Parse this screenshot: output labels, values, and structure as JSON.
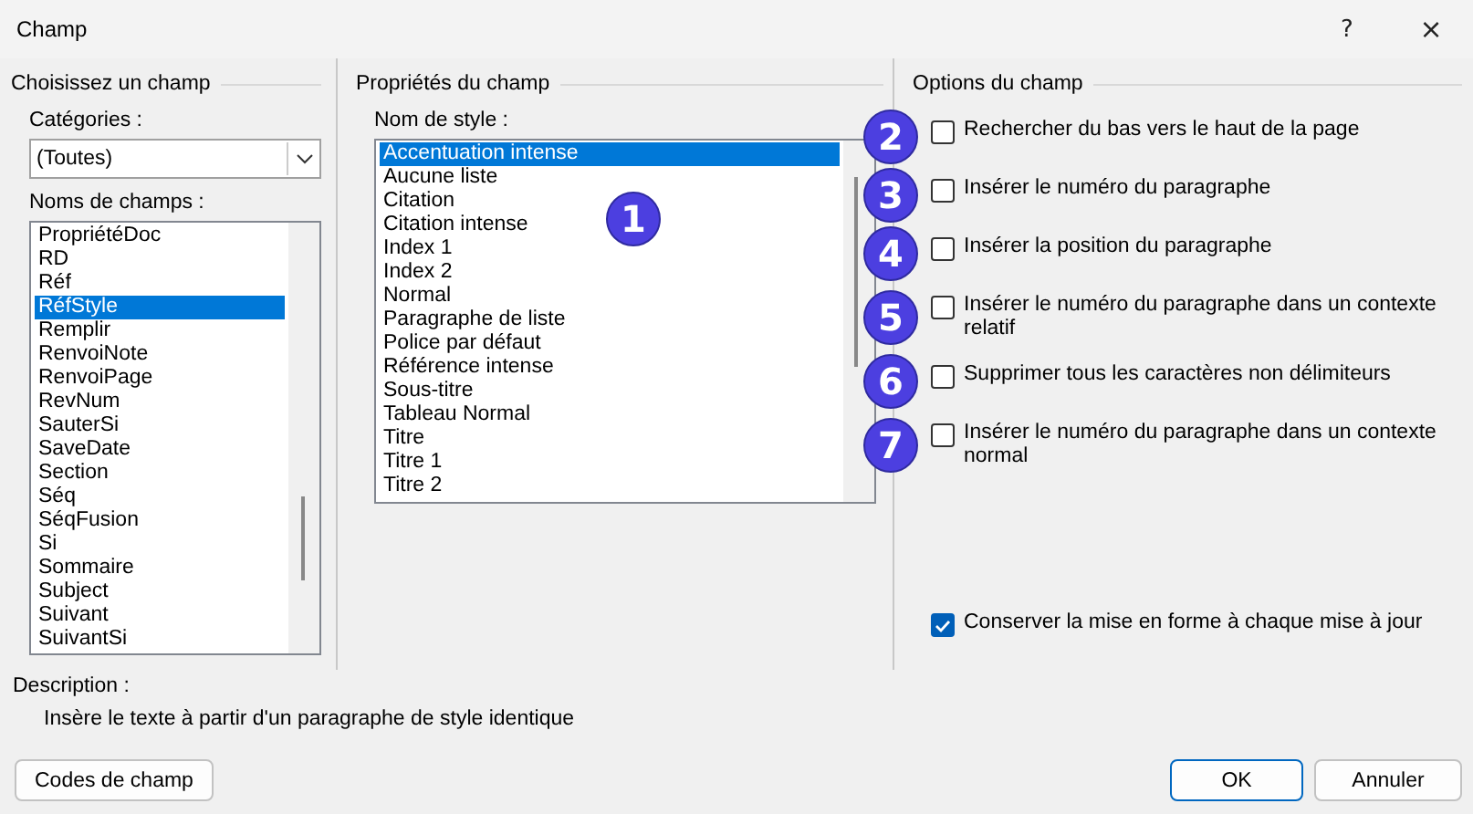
{
  "window": {
    "title": "Champ",
    "help": "?",
    "close": "×"
  },
  "field_chooser": {
    "heading": "Choisissez un champ",
    "categories_label": "Catégories :",
    "categories_value": "(Toutes)",
    "names_label": "Noms de champs :",
    "names": [
      {
        "label": "PropriétéDoc",
        "selected": false
      },
      {
        "label": "RD",
        "selected": false
      },
      {
        "label": "Réf",
        "selected": false
      },
      {
        "label": "RéfStyle",
        "selected": true
      },
      {
        "label": "Remplir",
        "selected": false
      },
      {
        "label": "RenvoiNote",
        "selected": false
      },
      {
        "label": "RenvoiPage",
        "selected": false
      },
      {
        "label": "RevNum",
        "selected": false
      },
      {
        "label": "SauterSi",
        "selected": false
      },
      {
        "label": "SaveDate",
        "selected": false
      },
      {
        "label": "Section",
        "selected": false
      },
      {
        "label": "Séq",
        "selected": false
      },
      {
        "label": "SéqFusion",
        "selected": false
      },
      {
        "label": "Si",
        "selected": false
      },
      {
        "label": "Sommaire",
        "selected": false
      },
      {
        "label": "Subject",
        "selected": false
      },
      {
        "label": "Suivant",
        "selected": false
      },
      {
        "label": "SuivantSi",
        "selected": false
      }
    ]
  },
  "field_properties": {
    "heading": "Propriétés du champ",
    "style_label": "Nom de style :",
    "callout": "1",
    "styles": [
      {
        "label": "Accentuation intense",
        "selected": true
      },
      {
        "label": "Aucune liste",
        "selected": false
      },
      {
        "label": "Citation",
        "selected": false
      },
      {
        "label": "Citation intense",
        "selected": false
      },
      {
        "label": "Index 1",
        "selected": false
      },
      {
        "label": "Index 2",
        "selected": false
      },
      {
        "label": "Normal",
        "selected": false
      },
      {
        "label": "Paragraphe de liste",
        "selected": false
      },
      {
        "label": "Police par défaut",
        "selected": false
      },
      {
        "label": "Référence intense",
        "selected": false
      },
      {
        "label": "Sous-titre",
        "selected": false
      },
      {
        "label": "Tableau Normal",
        "selected": false
      },
      {
        "label": "Titre",
        "selected": false
      },
      {
        "label": "Titre 1",
        "selected": false
      },
      {
        "label": "Titre 2",
        "selected": false
      }
    ]
  },
  "field_options": {
    "heading": "Options du champ",
    "options": [
      {
        "label": "Rechercher du bas vers le haut de la page",
        "checked": false,
        "callout": "2"
      },
      {
        "label": "Insérer le numéro du paragraphe",
        "checked": false,
        "callout": "3"
      },
      {
        "label": "Insérer la position du paragraphe",
        "checked": false,
        "callout": "4"
      },
      {
        "label": "Insérer le numéro du paragraphe dans un contexte relatif",
        "checked": false,
        "callout": "5"
      },
      {
        "label": "Supprimer tous les caractères non délimiteurs",
        "checked": false,
        "callout": "6"
      },
      {
        "label": "Insérer le numéro du paragraphe dans un contexte normal",
        "checked": false,
        "callout": "7"
      }
    ],
    "preserve": {
      "label": "Conserver la mise en forme à chaque mise à jour",
      "checked": true
    }
  },
  "description": {
    "label": "Description :",
    "text": "Insère le texte à partir d'un paragraphe de style identique"
  },
  "buttons": {
    "field_codes": "Codes de champ",
    "ok": "OK",
    "cancel": "Annuler"
  }
}
